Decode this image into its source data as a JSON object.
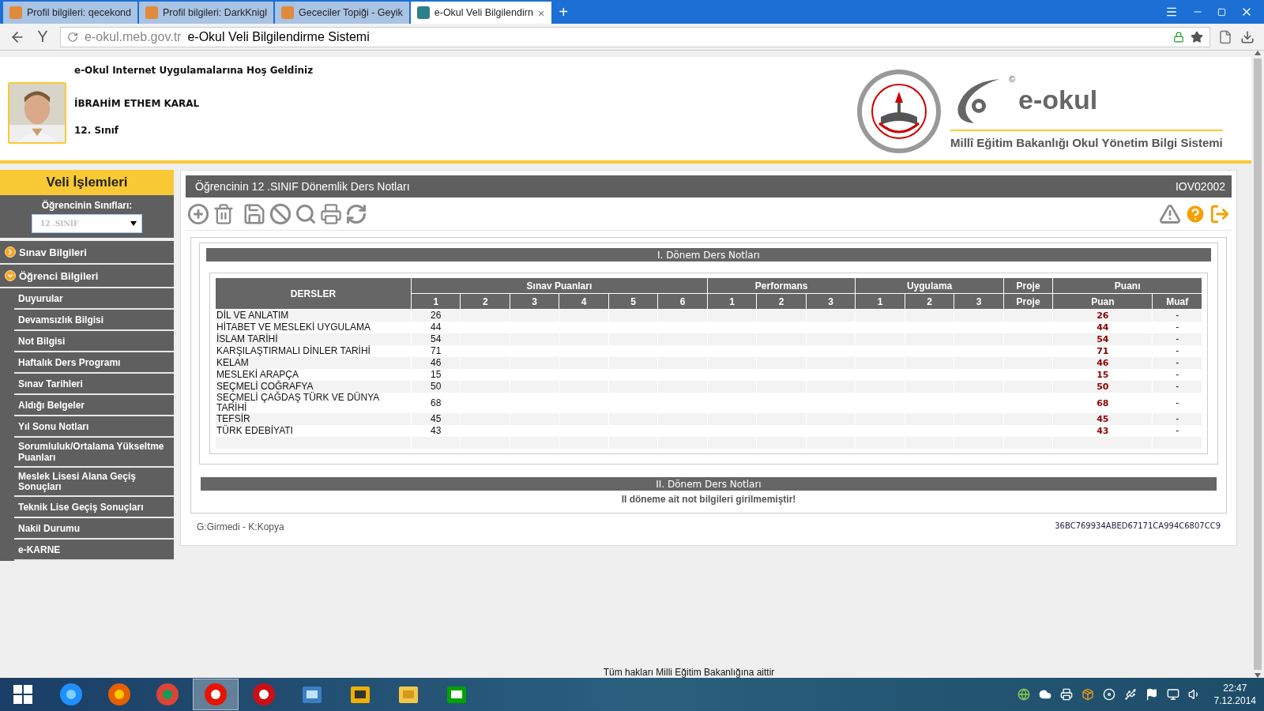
{
  "browser": {
    "tabs": [
      {
        "title": "Profil bilgileri: qecekond",
        "kind": "forum",
        "selected": false
      },
      {
        "title": "Profil bilgileri: DarkKnigl",
        "kind": "forum",
        "selected": false
      },
      {
        "title": "Gececiler Topiği - Geyik",
        "kind": "forum",
        "selected": false
      },
      {
        "title": "e-Okul Veli Bilgilendirn",
        "kind": "eokul",
        "selected": true
      }
    ],
    "close": "×",
    "new_tab": "+",
    "brand": "Y",
    "domain": "e-okul.meb.gov.tr",
    "page_title": "e-Okul Veli Bilgilendirme Sistemi"
  },
  "header": {
    "welcome": "e-Okul Internet Uygulamalarına Hoş Geldiniz",
    "student_name": "İBRAHİM ETHEM KARAL",
    "grade": "12. Sınıf",
    "copyright": "©",
    "logo_text": "e-okul",
    "ministry": "Millî Eğitim Bakanlığı Okul Yönetim Bilgi Sistemi"
  },
  "sidebar": {
    "title": "Veli İşlemleri",
    "class_label": "Öğrencinin Sınıfları:",
    "class_value": "12 .SINIF",
    "sections": [
      {
        "label": "Sınav Bilgileri",
        "expanded": false
      },
      {
        "label": "Öğrenci Bilgileri",
        "expanded": true,
        "children": [
          {
            "label": "Duyurular"
          },
          {
            "label": "Devamsızlık Bilgisi"
          },
          {
            "label": "Not Bilgisi"
          },
          {
            "label": "Haftalık Ders Programı"
          },
          {
            "label": "Sınav Tarihleri"
          },
          {
            "label": "Aldığı Belgeler"
          },
          {
            "label": "Yıl Sonu Notları"
          },
          {
            "label": "Sorumluluk/Ortalama Yükseltme Puanları"
          },
          {
            "label": "Meslek Lisesi Alana Geçiş Sonuçları"
          },
          {
            "label": "Teknik Lise Geçiş Sonuçları"
          },
          {
            "label": "Nakil Durumu"
          },
          {
            "label": "e-KARNE"
          }
        ]
      }
    ]
  },
  "panel": {
    "title": "Öğrencinin  12 .SINIF Dönemlik Ders Notları",
    "code": "IOV02002",
    "term_1": {
      "title": "I. Dönem Ders Notları",
      "subject_header": "DERSLER",
      "groups": [
        {
          "label": "Sınav Puanları",
          "columns": [
            "1",
            "2",
            "3",
            "4",
            "5",
            "6"
          ]
        },
        {
          "label": "Performans",
          "columns": [
            "1",
            "2",
            "3"
          ]
        },
        {
          "label": "Uygulama",
          "columns": [
            "1",
            "2",
            "3"
          ]
        },
        {
          "label": "Proje",
          "columns": [
            "Proje"
          ]
        },
        {
          "label": "Puanı",
          "columns": [
            "Puan",
            "Muaf"
          ]
        }
      ],
      "rows": [
        {
          "subject": "DİL VE ANLATIM",
          "exam_1": "26",
          "score": "26",
          "exempt": "-"
        },
        {
          "subject": "HİTABET VE MESLEKİ UYGULAMA",
          "exam_1": "44",
          "score": "44",
          "exempt": "-"
        },
        {
          "subject": "İSLAM TARİHİ",
          "exam_1": "54",
          "score": "54",
          "exempt": "-"
        },
        {
          "subject": "KARŞILAŞTIRMALI DİNLER TARİHİ",
          "exam_1": "71",
          "score": "71",
          "exempt": "-"
        },
        {
          "subject": "KELAM",
          "exam_1": "46",
          "score": "46",
          "exempt": "-"
        },
        {
          "subject": "MESLEKİ ARAPÇA",
          "exam_1": "15",
          "score": "15",
          "exempt": "-"
        },
        {
          "subject": "SEÇMELİ COĞRAFYA",
          "exam_1": "50",
          "score": "50",
          "exempt": "-"
        },
        {
          "subject": "SEÇMELİ ÇAĞDAŞ TÜRK VE DÜNYA TARİHİ",
          "exam_1": "68",
          "score": "68",
          "exempt": "-"
        },
        {
          "subject": "TEFSİR",
          "exam_1": "45",
          "score": "45",
          "exempt": "-"
        },
        {
          "subject": "TÜRK EDEBİYATI",
          "exam_1": "43",
          "score": "43",
          "exempt": "-"
        }
      ]
    },
    "term_2": {
      "title": "II. Dönem Ders Notları",
      "message": "II döneme ait not bilgileri girilmemiştir!"
    },
    "legend": "G:Girmedi - K:Kopya",
    "hash": "36BC769934ABED67171CA994C6807CC9"
  },
  "footer": "Tüm hakları Milli Eğitim Bakanlığına aittir",
  "taskbar": {
    "apps": [
      {
        "kind": "ie",
        "selected": false
      },
      {
        "kind": "firefox",
        "selected": false
      },
      {
        "kind": "chrome",
        "selected": false
      },
      {
        "kind": "yandex",
        "selected": true
      },
      {
        "kind": "opera",
        "selected": false
      },
      {
        "kind": "control",
        "selected": false
      },
      {
        "kind": "winamp",
        "selected": false
      },
      {
        "kind": "explorer",
        "selected": false
      },
      {
        "kind": "store",
        "selected": false
      }
    ],
    "time": "22:47",
    "date": "7.12.2014"
  }
}
